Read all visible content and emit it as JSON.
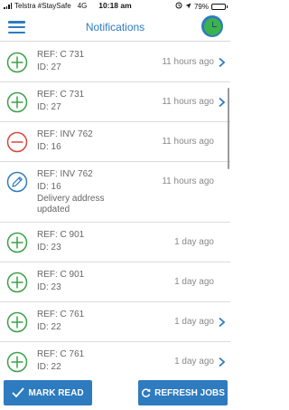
{
  "status_bar": {
    "carrier": "Telstra #StaySafe",
    "network": "4G",
    "time": "10:18 am",
    "battery": "79%",
    "battery_level": 0.79,
    "battery_color": "#f2c400"
  },
  "header": {
    "title": "Notifications",
    "menu_icon": "hamburger-menu-icon",
    "clock_icon": "clock-icon"
  },
  "colors": {
    "accent": "#2e7bbf",
    "add": "#3aa046",
    "cancel": "#d8453a",
    "edit": "#2e7bbf"
  },
  "notifications": [
    {
      "icon": "add",
      "ref": "REF: C 731",
      "id": "ID: 27",
      "note": "",
      "time": "11 hours ago",
      "chevron": true
    },
    {
      "icon": "add",
      "ref": "REF: C 731",
      "id": "ID: 27",
      "note": "",
      "time": "11 hours ago",
      "chevron": true
    },
    {
      "icon": "cancel",
      "ref": "REF: INV 762",
      "id": "ID: 16",
      "note": "",
      "time": "11 hours ago",
      "chevron": false
    },
    {
      "icon": "edit",
      "ref": "REF: INV 762",
      "id": "ID: 16",
      "note": "Delivery address updated",
      "time": "11 hours ago",
      "chevron": false
    },
    {
      "icon": "add",
      "ref": "REF: C 901",
      "id": "ID: 23",
      "note": "",
      "time": "1 day ago",
      "chevron": false
    },
    {
      "icon": "add",
      "ref": "REF: C 901",
      "id": "ID: 23",
      "note": "",
      "time": "1 day ago",
      "chevron": false
    },
    {
      "icon": "add",
      "ref": "REF: C 761",
      "id": "ID: 22",
      "note": "",
      "time": "1 day ago",
      "chevron": true
    },
    {
      "icon": "add",
      "ref": "REF: C 761",
      "id": "ID: 22",
      "note": "",
      "time": "1 day ago",
      "chevron": true
    }
  ],
  "actions": {
    "mark_read": "MARK READ",
    "refresh_jobs": "REFRESH JOBS"
  }
}
